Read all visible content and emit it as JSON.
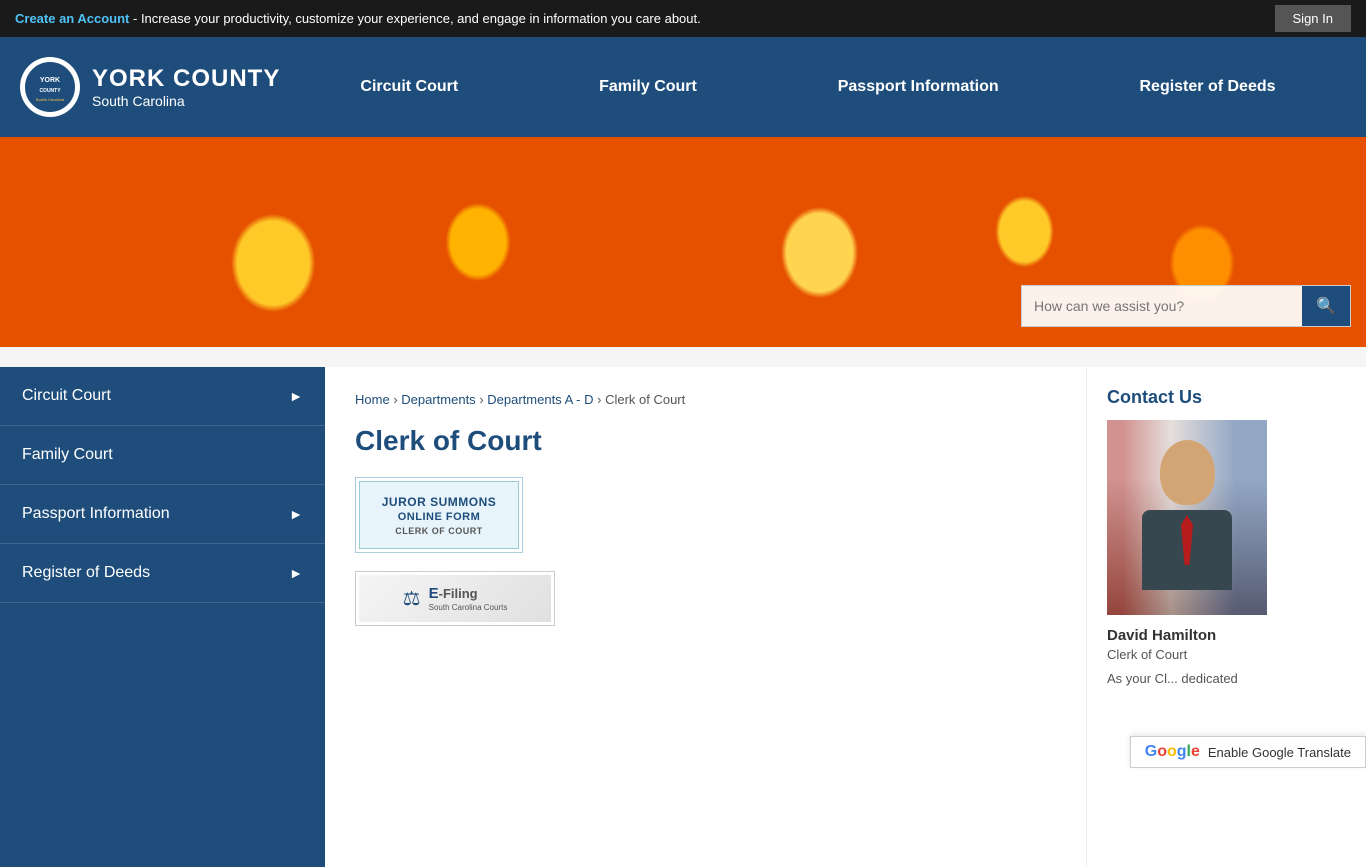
{
  "topbar": {
    "create_account_text": "Create an Account",
    "topbar_message": " - Increase your productivity, customize your experience, and engage in information you care about.",
    "sign_in_label": "Sign In"
  },
  "header": {
    "logo_title": "YORK COUNTY",
    "logo_subtitle": "South Carolina",
    "nav": {
      "circuit_court": "Circuit Court",
      "family_court": "Family Court",
      "passport_info": "Passport Information",
      "register_of_deeds": "Register of Deeds"
    }
  },
  "search": {
    "placeholder": "How can we assist you?"
  },
  "sidebar": {
    "items": [
      {
        "label": "Circuit Court",
        "has_arrow": true
      },
      {
        "label": "Family Court",
        "has_arrow": false
      },
      {
        "label": "Passport Information",
        "has_arrow": true
      },
      {
        "label": "Register of Deeds",
        "has_arrow": true
      }
    ]
  },
  "breadcrumb": {
    "home": "Home",
    "departments": "Departments",
    "departments_ad": "Departments A - D",
    "current": "Clerk of Court"
  },
  "page": {
    "title": "Clerk of Court",
    "juror_card": {
      "line1": "JUROR SUMMONS",
      "line2": "ONLINE FORM",
      "line3": "CLERK OF COURT"
    },
    "efiling": {
      "icon": "⚖",
      "main_text": "E-Filing",
      "sub_text": "South Carolina Courts"
    }
  },
  "contact": {
    "title": "Contact Us",
    "name": "David Hamilton",
    "role": "Clerk of Court",
    "description": "As your Cl... dedicated"
  },
  "translate": {
    "label": "Enable Google Translate"
  }
}
